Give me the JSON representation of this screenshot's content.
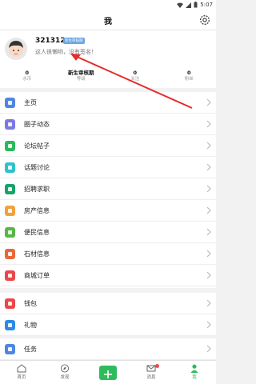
{
  "status": {
    "time": "5:07"
  },
  "header": {
    "title": "我"
  },
  "profile": {
    "username": "321312",
    "badge": "新生审核期",
    "signature": "这人很懒哟，没有签名！",
    "stats": [
      {
        "value": "0",
        "label": "水币"
      },
      {
        "value": "新生审核期",
        "label": "等级"
      },
      {
        "value": "0",
        "label": "关注"
      },
      {
        "value": "0",
        "label": "粉丝"
      }
    ]
  },
  "menu_group1": [
    {
      "label": "主页",
      "icon": "home-page-icon",
      "color": "#4f86e0"
    },
    {
      "label": "圈子动态",
      "icon": "circle-icon",
      "color": "#7d78e6"
    },
    {
      "label": "论坛帖子",
      "icon": "chat-bubble-icon",
      "color": "#2cb85c"
    },
    {
      "label": "话题讨论",
      "icon": "topic-icon",
      "color": "#2fc2c9"
    },
    {
      "label": "招聘求职",
      "icon": "recruit-icon",
      "color": "#1aa26b"
    },
    {
      "label": "房产信息",
      "icon": "house-icon",
      "color": "#f0a23c"
    },
    {
      "label": "便民信息",
      "icon": "service-icon",
      "color": "#57b746"
    },
    {
      "label": "石材信息",
      "icon": "stone-icon",
      "color": "#e86838"
    },
    {
      "label": "商城订单",
      "icon": "order-icon",
      "color": "#e9474a"
    }
  ],
  "menu_group2": [
    {
      "label": "钱包",
      "icon": "wallet-icon",
      "color": "#e9474a"
    },
    {
      "label": "礼物",
      "icon": "gift-icon",
      "color": "#2e8ae6"
    }
  ],
  "menu_group3": [
    {
      "label": "任务",
      "icon": "task-icon",
      "color": "#4f86e0"
    }
  ],
  "tabbar": [
    {
      "label": "首页",
      "icon": "home-icon"
    },
    {
      "label": "发现",
      "icon": "compass-icon"
    },
    {
      "label": "",
      "icon": "plus-icon"
    },
    {
      "label": "消息",
      "icon": "mail-icon"
    },
    {
      "label": "我",
      "icon": "person-icon"
    }
  ]
}
